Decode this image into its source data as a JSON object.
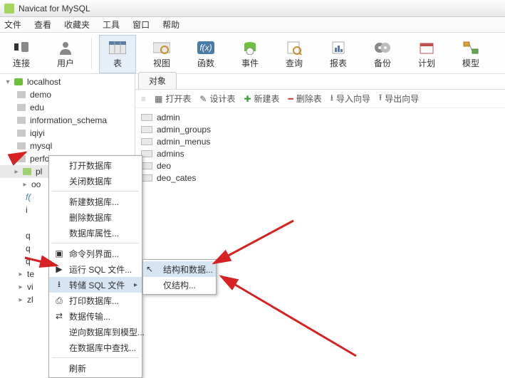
{
  "title": "Navicat for MySQL",
  "menubar": [
    "文件",
    "查看",
    "收藏夹",
    "工具",
    "窗口",
    "帮助"
  ],
  "toolbar": {
    "items": [
      {
        "label": "连接",
        "icon": "plug"
      },
      {
        "label": "用户",
        "icon": "user"
      },
      {
        "label": "表",
        "icon": "table",
        "selected": true
      },
      {
        "label": "视图",
        "icon": "view"
      },
      {
        "label": "函数",
        "icon": "fx"
      },
      {
        "label": "事件",
        "icon": "event"
      },
      {
        "label": "查询",
        "icon": "query"
      },
      {
        "label": "报表",
        "icon": "report"
      },
      {
        "label": "备份",
        "icon": "backup"
      },
      {
        "label": "计划",
        "icon": "schedule"
      },
      {
        "label": "模型",
        "icon": "model"
      }
    ]
  },
  "tree": {
    "host": "localhost",
    "databases": [
      "demo",
      "edu",
      "information_schema",
      "iqiyi",
      "mysql",
      "performance_schema"
    ],
    "selected_db_prefix": "pl",
    "partial": [
      "oo",
      "f(",
      "i",
      "",
      "q",
      "q",
      "q",
      "te",
      "vi",
      "zl"
    ]
  },
  "tabs": {
    "active": "对象"
  },
  "actionbar": {
    "open": "打开表",
    "design": "设计表",
    "new": "新建表",
    "del": "删除表",
    "import": "导入向导",
    "export": "导出向导"
  },
  "tables": [
    "admin",
    "admin_groups",
    "admin_menus",
    "admins",
    "deo",
    "deo_cates"
  ],
  "context_main": {
    "items": [
      {
        "label": "打开数据库",
        "icon": ""
      },
      {
        "label": "关闭数据库",
        "icon": ""
      },
      {
        "sep": true
      },
      {
        "label": "新建数据库...",
        "icon": ""
      },
      {
        "label": "删除数据库",
        "icon": ""
      },
      {
        "label": "数据库属性...",
        "icon": ""
      },
      {
        "sep": true
      },
      {
        "label": "命令列界面...",
        "icon": "cmd"
      },
      {
        "label": "运行 SQL 文件...",
        "icon": "run"
      },
      {
        "label": "转储 SQL 文件",
        "icon": "dump",
        "submenu": true,
        "selected": true
      },
      {
        "label": "打印数据库...",
        "icon": "print"
      },
      {
        "label": "数据传输...",
        "icon": "transfer"
      },
      {
        "label": "逆向数据库到模型...",
        "icon": ""
      },
      {
        "label": "在数据库中查找...",
        "icon": ""
      },
      {
        "sep": true
      },
      {
        "label": "刷新",
        "icon": ""
      }
    ]
  },
  "context_sub": {
    "items": [
      {
        "label": "结构和数据...",
        "selected": true
      },
      {
        "label": "仅结构..."
      }
    ]
  }
}
